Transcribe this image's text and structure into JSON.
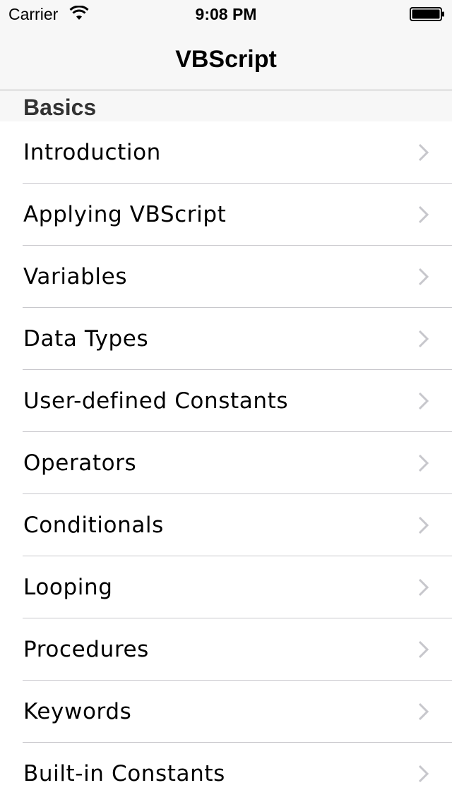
{
  "status_bar": {
    "carrier": "Carrier",
    "time": "9:08 PM",
    "icons": [
      "wifi-icon",
      "battery-icon"
    ]
  },
  "nav_bar": {
    "title": "VBScript"
  },
  "section": {
    "title": "Basics"
  },
  "items": [
    {
      "label": "Introduction"
    },
    {
      "label": "Applying VBScript"
    },
    {
      "label": "Variables"
    },
    {
      "label": "Data Types"
    },
    {
      "label": "User-defined Constants"
    },
    {
      "label": "Operators"
    },
    {
      "label": "Conditionals"
    },
    {
      "label": "Looping"
    },
    {
      "label": "Procedures"
    },
    {
      "label": "Keywords"
    },
    {
      "label": "Built-in Constants"
    }
  ],
  "colors": {
    "bar_background": "#f7f7f7",
    "separator": "#c8c7cc",
    "chevron": "#c7c7cc",
    "section_text": "#333333"
  }
}
